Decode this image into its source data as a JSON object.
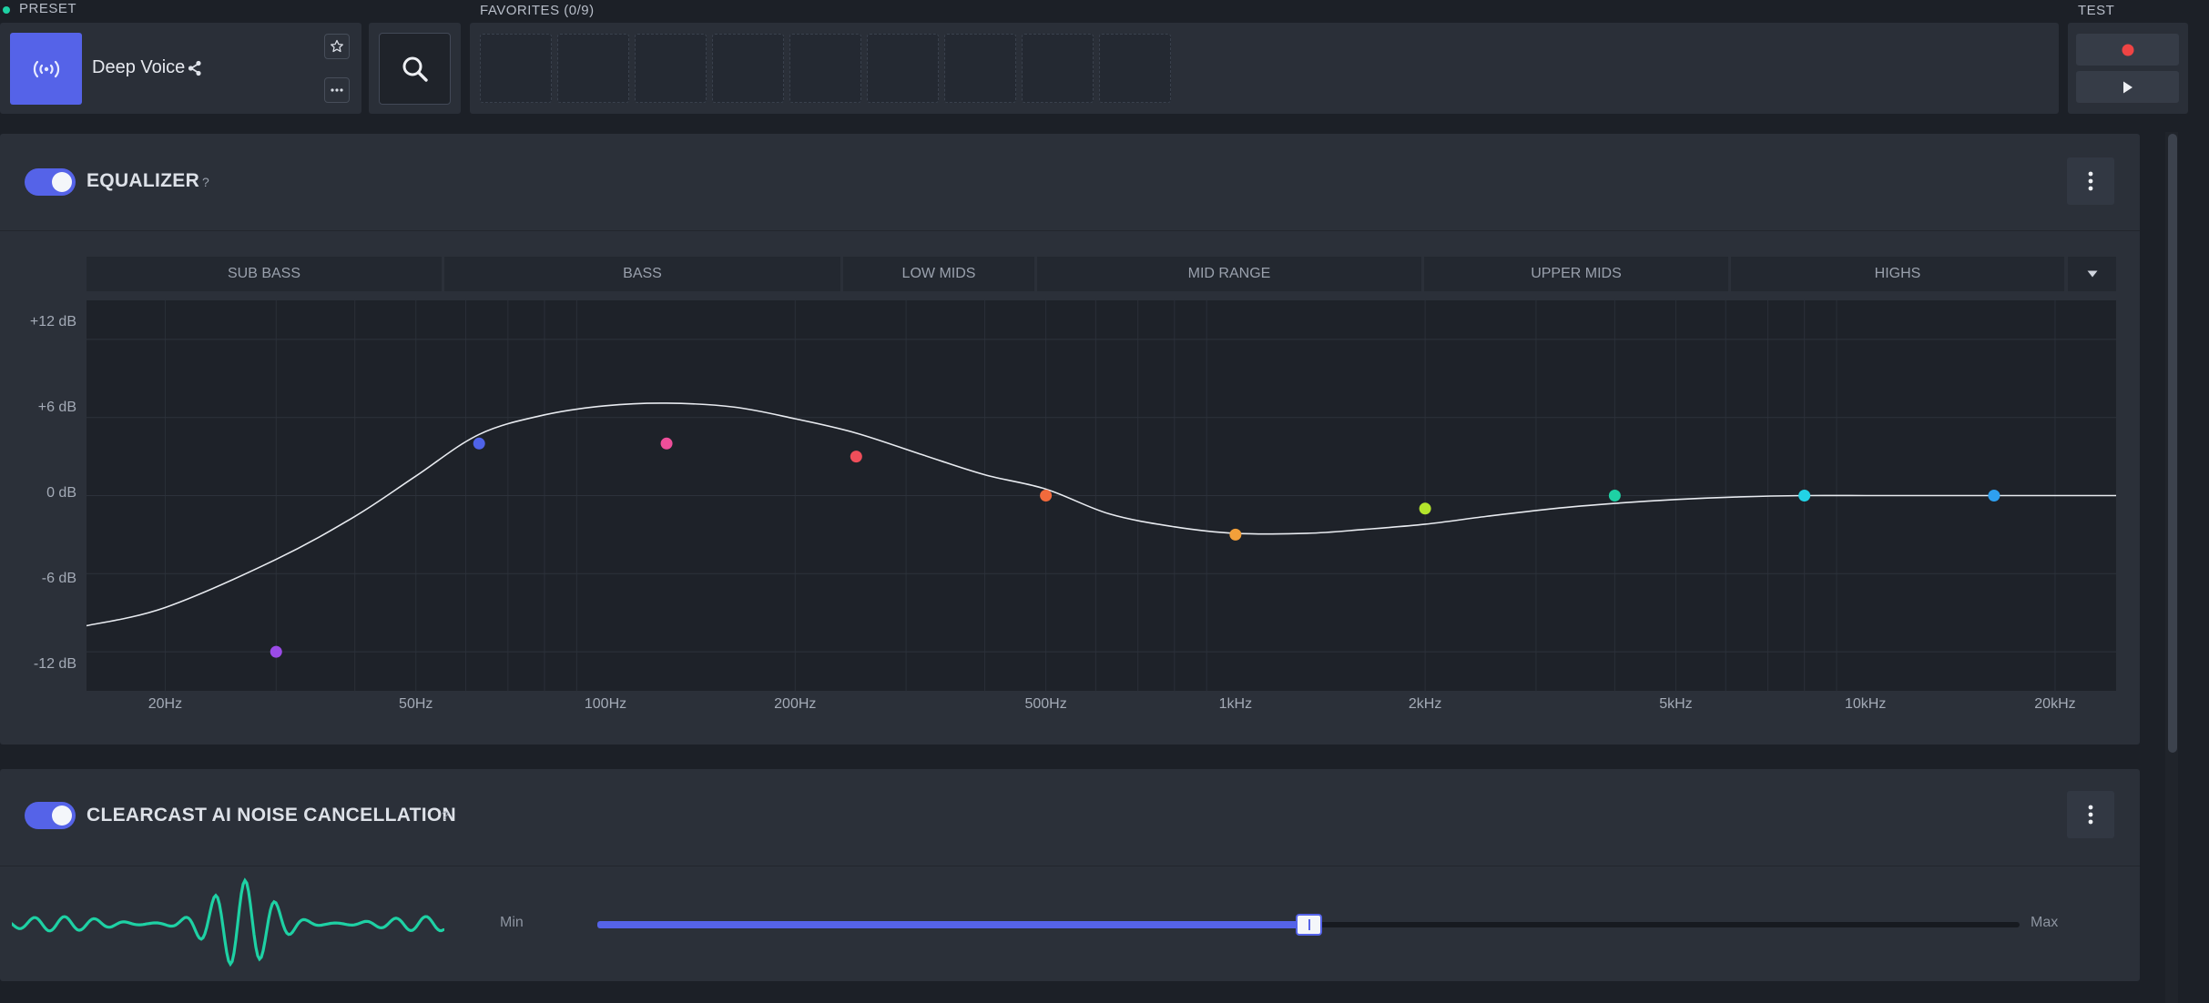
{
  "preset": {
    "label": "PRESET",
    "name": "Deep Voice",
    "tile_icon": "voice-wave-icon",
    "share_icon": "share-icon",
    "favorite_icon": "star-icon",
    "more_icon": "ellipsis-icon"
  },
  "search": {
    "icon": "search-icon"
  },
  "favorites": {
    "label": "FAVORITES (0/9)",
    "slots": 9
  },
  "test": {
    "label": "TEST",
    "record_icon": "record-icon",
    "play_icon": "play-icon",
    "record_color": "#ef4444"
  },
  "accent": "#5563e8",
  "equalizer": {
    "title": "EQUALIZER",
    "help": "?",
    "enabled": true,
    "bands": [
      "SUB BASS",
      "BASS",
      "LOW MIDS",
      "MID RANGE",
      "UPPER MIDS",
      "HIGHS"
    ],
    "dropdown_icon": "caret-down-icon"
  },
  "noise": {
    "title": "CLEARCAST AI NOISE CANCELLATION",
    "help": "?",
    "enabled": true,
    "min_label": "Min",
    "max_label": "Max",
    "level": 0.5,
    "waveform_color": "#1ed1a4"
  },
  "chart_data": {
    "type": "line",
    "xscale": "log",
    "xlim": [
      15,
      25000
    ],
    "ylim": [
      -15,
      15
    ],
    "y_ticks": [
      12,
      6,
      0,
      -6,
      -12
    ],
    "y_tick_labels": [
      "+12 dB",
      "+6 dB",
      "0 dB",
      "-6 dB",
      "-12 dB"
    ],
    "x_ticks": [
      20,
      50,
      100,
      200,
      500,
      1000,
      2000,
      5000,
      10000,
      20000
    ],
    "x_tick_labels": [
      "20Hz",
      "50Hz",
      "100Hz",
      "200Hz",
      "500Hz",
      "1kHz",
      "2kHz",
      "5kHz",
      "10kHz",
      "20kHz"
    ],
    "grid": true,
    "series": [
      {
        "points": [
          {
            "x": 30,
            "y": -12,
            "color": "#9b4be8"
          },
          {
            "x": 63,
            "y": 4,
            "color": "#4f63e8"
          },
          {
            "x": 125,
            "y": 4,
            "color": "#ee4e9a"
          },
          {
            "x": 250,
            "y": 3,
            "color": "#ef4e5a"
          },
          {
            "x": 500,
            "y": 0,
            "color": "#f26a3c"
          },
          {
            "x": 1000,
            "y": -3,
            "color": "#f3a03a"
          },
          {
            "x": 2000,
            "y": -1,
            "color": "#b4e52c"
          },
          {
            "x": 4000,
            "y": 0,
            "color": "#1ed1a4"
          },
          {
            "x": 8000,
            "y": 0,
            "color": "#22d3e6"
          },
          {
            "x": 16000,
            "y": 0,
            "color": "#2ea0f0"
          }
        ]
      }
    ],
    "curve": {
      "x": [
        15,
        20,
        30,
        40,
        50,
        63,
        80,
        100,
        125,
        160,
        200,
        250,
        320,
        400,
        500,
        630,
        800,
        1000,
        1300,
        1600,
        2000,
        2500,
        3200,
        4000,
        5000,
        6300,
        8000,
        10000,
        16000,
        25000
      ],
      "y": [
        -10,
        -8.6,
        -4.9,
        -1.6,
        1.5,
        4.7,
        6.2,
        6.9,
        7.1,
        6.8,
        5.9,
        4.8,
        3.1,
        1.6,
        0.5,
        -1.4,
        -2.4,
        -2.9,
        -2.9,
        -2.6,
        -2.2,
        -1.6,
        -1,
        -0.6,
        -0.3,
        -0.1,
        0,
        0,
        0,
        0
      ]
    }
  }
}
